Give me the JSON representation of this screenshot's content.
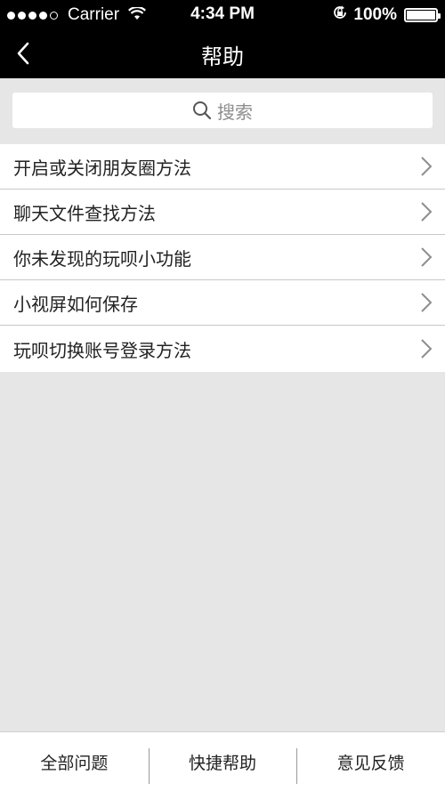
{
  "status_bar": {
    "carrier": "Carrier",
    "time": "4:34 PM",
    "battery": "100%",
    "battery_level": 1.0,
    "signal_bars_filled": 4,
    "signal_bars_total": 5
  },
  "nav": {
    "title": "帮助",
    "back_icon": "chevron-left-icon"
  },
  "search": {
    "placeholder": "搜索",
    "icon": "search-icon"
  },
  "help_items": [
    {
      "label": "开启或关闭朋友圈方法"
    },
    {
      "label": "聊天文件查找方法"
    },
    {
      "label": "你未发现的玩呗小功能"
    },
    {
      "label": "小视屏如何保存"
    },
    {
      "label": "玩呗切换账号登录方法"
    }
  ],
  "tabs": [
    {
      "label": "全部问题"
    },
    {
      "label": "快捷帮助"
    },
    {
      "label": "意见反馈"
    }
  ],
  "colors": {
    "nav_background": "#000000",
    "page_background": "#e6e6e6",
    "chevron": "#8e8e8e"
  }
}
